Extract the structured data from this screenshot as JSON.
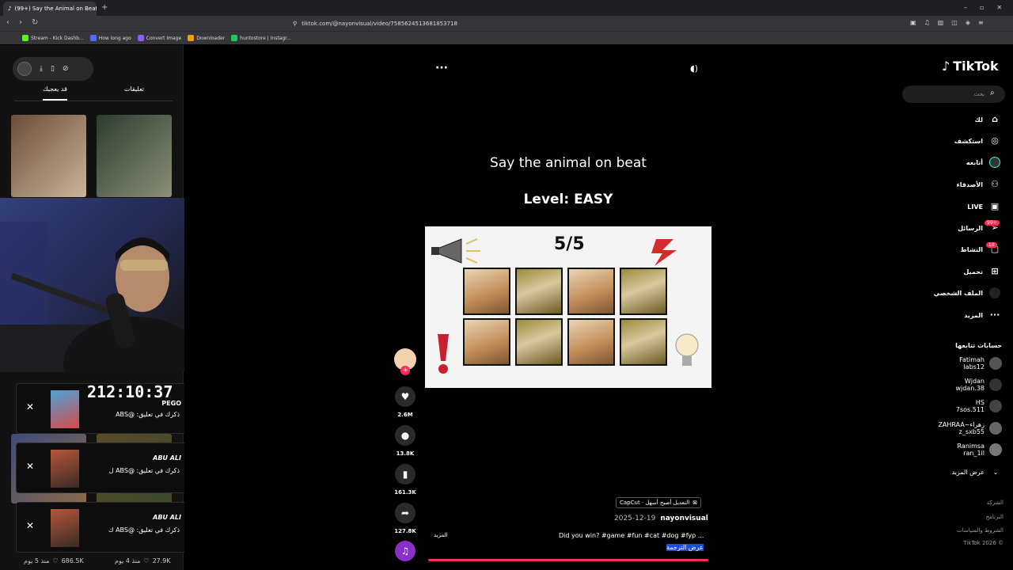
{
  "browser": {
    "tab_title": "(99+) Say the Animal on Beat",
    "url": "tiktok.com/@nayonvisual/video/7585624513681853718",
    "bookmarks": [
      "Stream - Kick Dashb...",
      "How long ago",
      "Convert Image",
      "Downloader",
      "huntostore | Instagr..."
    ]
  },
  "left_panel": {
    "tabs": [
      "قد يعجبك",
      "تعليقات"
    ],
    "timer": "212:10:37",
    "notifications": [
      {
        "name": "PEGO",
        "text": "ذكرك في تعليق: @ABS"
      },
      {
        "name": "ABU ALI",
        "text": "ذكرك في تعليق: @ABS ل"
      },
      {
        "name": "ABU ALI",
        "text": "ذكرك في تعليق: @ABS ك"
      }
    ],
    "stats": [
      {
        "likes": "686.5K",
        "age": "منذ 5 يوم"
      },
      {
        "likes": "27.9K",
        "age": "منذ 4 يوم"
      }
    ]
  },
  "video": {
    "caption_line1": "Say the animal on beat",
    "caption_line2": "Level: EASY",
    "score": "5/5",
    "grid": [
      "cat",
      "dog",
      "cat",
      "dog",
      "cat",
      "dog",
      "cat",
      "dog"
    ],
    "likes": "2.6M",
    "comments": "13.8K",
    "saves": "161.3K",
    "shares": "127.8K",
    "capcut": "CapCut · التعديل أصبح أسهل",
    "author": "nayonvisual",
    "date": "2025-12-19",
    "description": "Did you win? #game #fun #cat #dog #fyp ...",
    "more_label": "المزيد",
    "translate": "عرض الترجمة",
    "progress": 1.0
  },
  "sidebar": {
    "logo": "TikTok",
    "search_placeholder": "بحث",
    "nav": [
      {
        "label": "لك",
        "icon": "home-icon"
      },
      {
        "label": "استكشف",
        "icon": "compass-icon"
      },
      {
        "label": "أتابعه",
        "icon": "following-icon"
      },
      {
        "label": "الأصدقاء",
        "icon": "friends-icon"
      },
      {
        "label": "LIVE",
        "icon": "live-icon"
      },
      {
        "label": "الرسائل",
        "icon": "message-icon",
        "badge": "99+"
      },
      {
        "label": "النشاط",
        "icon": "activity-icon",
        "badge": "18"
      },
      {
        "label": "تحميل",
        "icon": "upload-icon"
      },
      {
        "label": "الملف الشخصي",
        "icon": "profile-icon"
      },
      {
        "label": "المزيد",
        "icon": "more-icon"
      }
    ],
    "following_header": "حسابات تتابعها",
    "following": [
      {
        "name": "Fatimah",
        "handle": "labs12"
      },
      {
        "name": "Wjdan",
        "handle": "wjdan.38"
      },
      {
        "name": "HS",
        "handle": "7sos.511"
      },
      {
        "name": "ZAHRAA~زهراء",
        "handle": "z_sxb55"
      },
      {
        "name": "Ranimsa",
        "handle": "ran_1il"
      }
    ],
    "show_more": "عرض المزيد",
    "footer": [
      "الشركة",
      "البرنامج",
      "الشروط والسياسات",
      "TikTok 2026 ©"
    ]
  },
  "colors": {
    "accent": "#fe2c55",
    "bg": "#000000"
  }
}
